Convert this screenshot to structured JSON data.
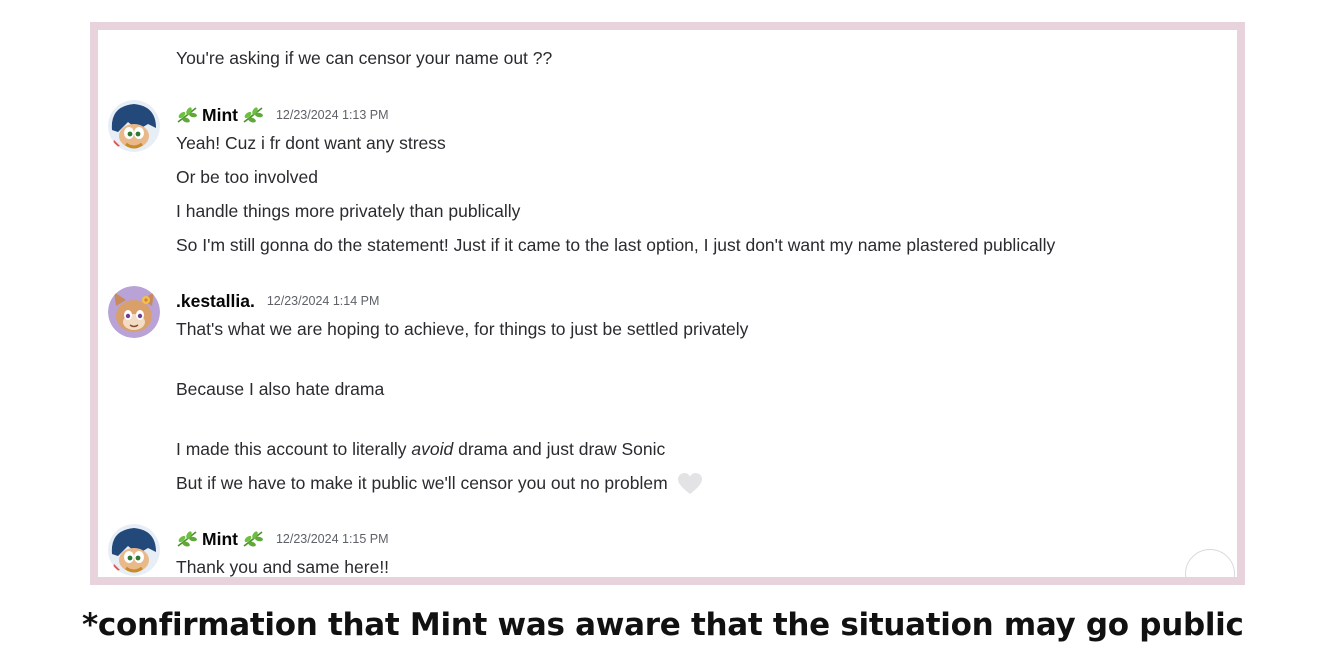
{
  "messages": [
    {
      "continuation": true,
      "lines": [
        "You're asking if we can censor your name out ??"
      ]
    },
    {
      "username": "Mint",
      "timestamp": "12/23/2024 1:13 PM",
      "avatar": "mint-avatar",
      "lines": [
        "Yeah! Cuz i fr dont want any stress",
        "Or be too involved",
        "I handle things more privately than publically",
        "So I'm still gonna do the statement! Just if it came to the last option, I just don't want my name plastered publically"
      ]
    },
    {
      "username": ".kestallia.",
      "timestamp": "12/23/2024 1:14 PM",
      "avatar": "kestallia-avatar",
      "lines": [
        "That's what we are hoping to achieve, for things to just be settled privately",
        "Because I also hate drama",
        "I made this account to literally ",
        "avoid",
        " drama and just draw Sonic",
        "But if we have to make it public we'll censor you out no problem"
      ]
    },
    {
      "username": "Mint",
      "timestamp": "12/23/2024 1:15 PM",
      "avatar": "mint-avatar",
      "lines": [
        "Thank you and same here!!"
      ]
    }
  ],
  "caption": "*confirmation that Mint was aware that the situation may go public",
  "colors": {
    "frame_border": "#e8d3dd",
    "leaf_green": "#5fa83a",
    "heart_gray": "#e3e3e6"
  }
}
